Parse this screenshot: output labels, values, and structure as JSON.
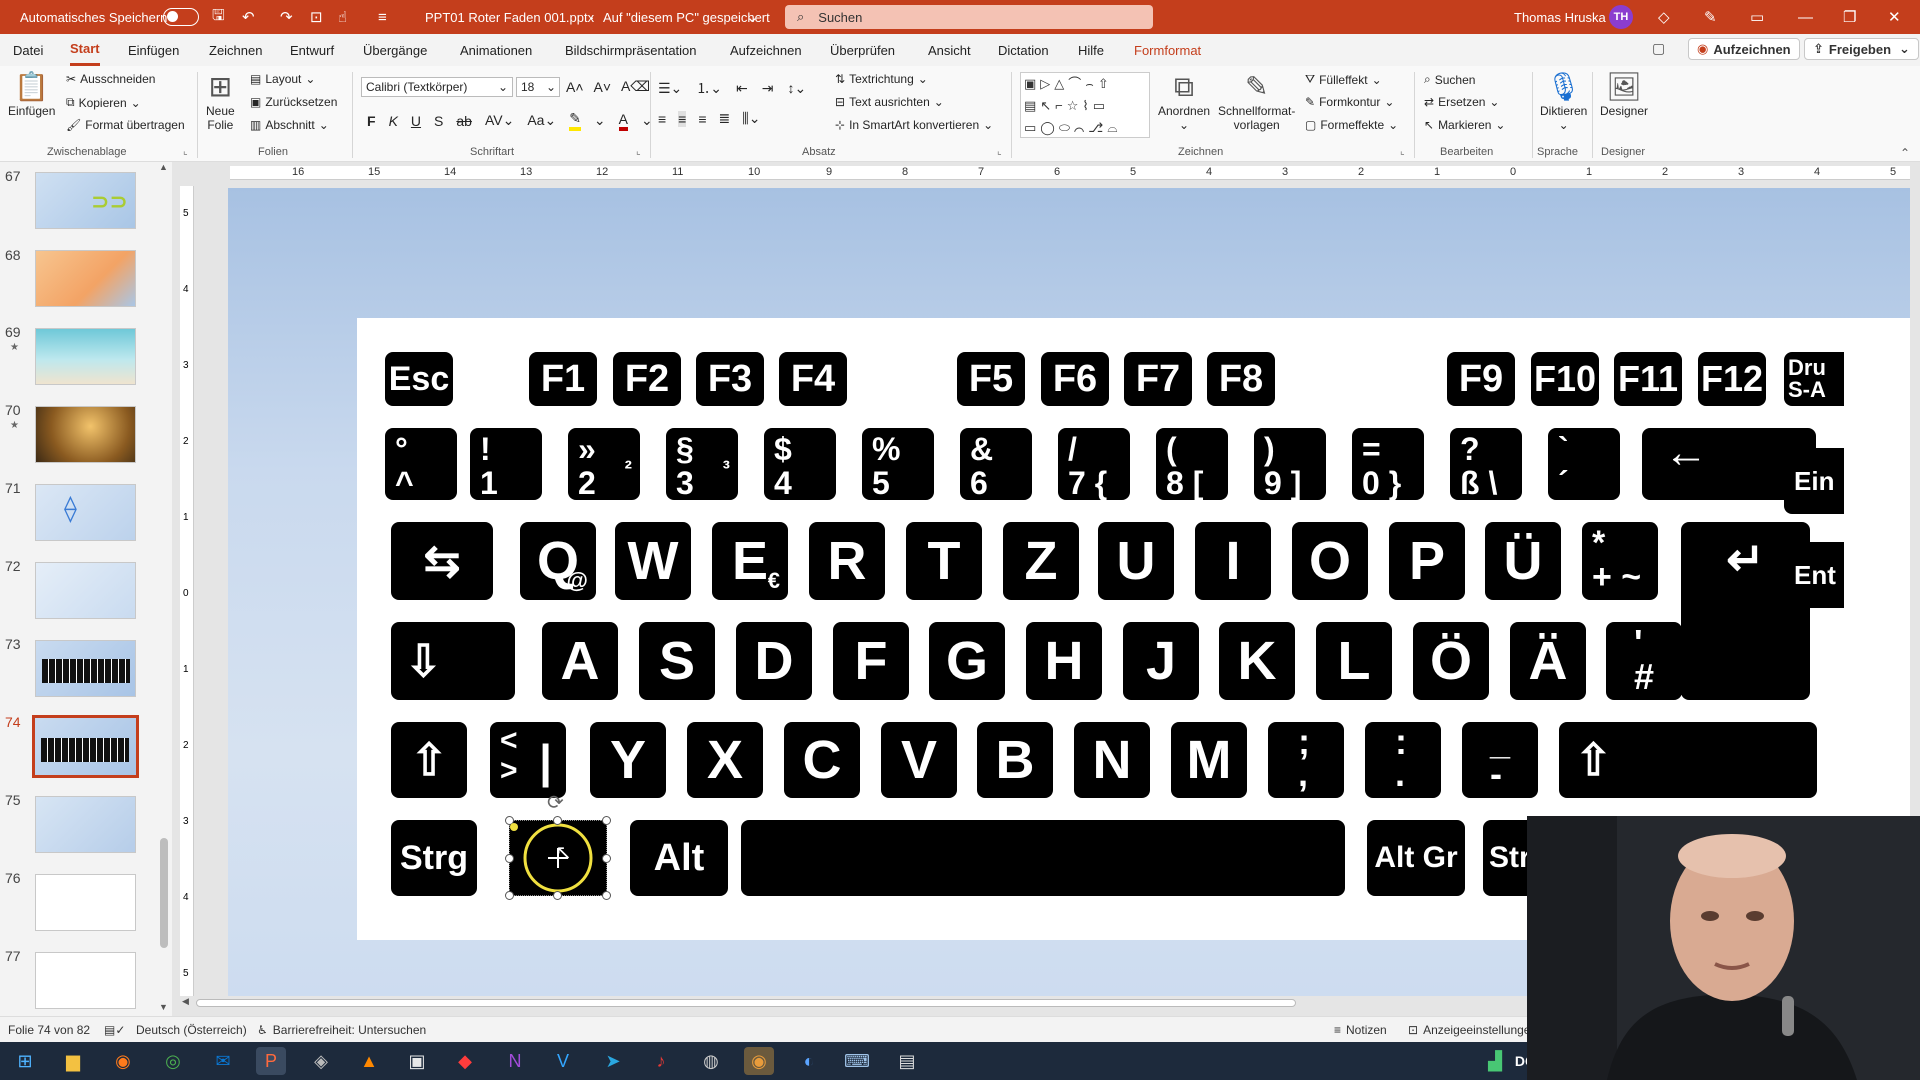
{
  "titlebar": {
    "autosave_label": "Automatisches Speichern",
    "doc_title": "PPT01 Roter Faden 001.pptx",
    "doc_location": "Auf \"diesem PC\" gespeichert",
    "search_placeholder": "Suchen",
    "user_name": "Thomas Hruska",
    "user_initials": "TH"
  },
  "menu": {
    "tabs": [
      "Datei",
      "Start",
      "Einfügen",
      "Zeichnen",
      "Entwurf",
      "Übergänge",
      "Animationen",
      "Bildschirmpräsentation",
      "Aufzeichnen",
      "Überprüfen",
      "Ansicht",
      "Dictation",
      "Hilfe",
      "Formformat"
    ],
    "active_tab": "Start",
    "record_button": "Aufzeichnen",
    "share_button": "Freigeben"
  },
  "ribbon": {
    "clipboard": {
      "paste": "Einfügen",
      "cut": "Ausschneiden",
      "copy": "Kopieren",
      "format_painter": "Format übertragen",
      "group": "Zwischenablage"
    },
    "slides": {
      "new_slide_1": "Neue",
      "new_slide_2": "Folie",
      "layout": "Layout",
      "reset": "Zurücksetzen",
      "section": "Abschnitt",
      "group": "Folien"
    },
    "font": {
      "name": "Calibri (Textkörper)",
      "size": "18",
      "group": "Schriftart"
    },
    "paragraph": {
      "text_direction": "Textrichtung",
      "align_text": "Text ausrichten",
      "smartart": "In SmartArt konvertieren",
      "group": "Absatz"
    },
    "drawing": {
      "arrange": "Anordnen",
      "quick_styles_1": "Schnellformat-",
      "quick_styles_2": "vorlagen",
      "fill": "Fülleffekt",
      "outline": "Formkontur",
      "effects": "Formeffekte",
      "group": "Zeichnen"
    },
    "editing": {
      "find": "Suchen",
      "replace": "Ersetzen",
      "select": "Markieren",
      "group": "Bearbeiten"
    },
    "voice": {
      "dictate": "Diktieren",
      "group": "Sprache"
    },
    "designer": {
      "label": "Designer",
      "group": "Designer"
    }
  },
  "slides_pane": {
    "numbers": [
      "67",
      "68",
      "69",
      "70",
      "71",
      "72",
      "73",
      "74",
      "75",
      "76",
      "77"
    ],
    "active": "74"
  },
  "ruler": {
    "top": [
      "16",
      "15",
      "14",
      "13",
      "12",
      "11",
      "10",
      "9",
      "8",
      "7",
      "6",
      "5",
      "4",
      "3",
      "2",
      "1",
      "0",
      "1",
      "2",
      "3",
      "4",
      "5"
    ],
    "left": [
      "5",
      "4",
      "3",
      "2",
      "1",
      "0",
      "1",
      "2",
      "3",
      "4",
      "5"
    ]
  },
  "keyboard": {
    "row_f": [
      "Esc",
      "F1",
      "F2",
      "F3",
      "F4",
      "F5",
      "F6",
      "F7",
      "F8",
      "F9",
      "F10",
      "F11",
      "F12"
    ],
    "row_f_partial": "Dru\nS-A",
    "row_num": [
      {
        "top": "°",
        "bottom": "^"
      },
      {
        "top": "!",
        "bottom": "1"
      },
      {
        "top": "»",
        "bottom": "2",
        "sub": "²"
      },
      {
        "top": "§",
        "bottom": "3",
        "sub": "³"
      },
      {
        "top": "$",
        "bottom": "4"
      },
      {
        "top": "%",
        "bottom": "5"
      },
      {
        "top": "&",
        "bottom": "6"
      },
      {
        "top": "/",
        "bottom": "7 {"
      },
      {
        "top": "(",
        "bottom": "8 ["
      },
      {
        "top": ")",
        "bottom": "9 ]"
      },
      {
        "top": "=",
        "bottom": "0 }"
      },
      {
        "top": "?",
        "bottom": "ß \\"
      },
      {
        "top": "`",
        "bottom": "´"
      }
    ],
    "row_num_partial": "Ein",
    "row_q": [
      "Q",
      "W",
      "E",
      "R",
      "T",
      "Z",
      "U",
      "I",
      "O",
      "P",
      "Ü"
    ],
    "q_sub": "@",
    "e_sub": "€",
    "plus_key": {
      "top": "*",
      "bottom": "+ ~"
    },
    "row_q_partial": "Ent",
    "row_a": [
      "A",
      "S",
      "D",
      "F",
      "G",
      "H",
      "J",
      "K",
      "L",
      "Ö",
      "Ä"
    ],
    "hash_key": {
      "top": "'",
      "bottom": "#"
    },
    "row_y": [
      "Y",
      "X",
      "C",
      "V",
      "B",
      "N",
      "M"
    ],
    "lt_key": {
      "top": "<",
      "bottom": ">",
      "sub": "|"
    },
    "semi_key": {
      "top": ";",
      "bottom": ","
    },
    "colon_key": {
      "top": ":",
      "bottom": "."
    },
    "dash_key": {
      "top": "_",
      "bottom": "-"
    },
    "row_bottom": [
      "Strg",
      "Alt",
      "Alt Gr"
    ],
    "row_bottom_partial": "Str"
  },
  "statusbar": {
    "slide_info": "Folie 74 von 82",
    "language": "Deutsch (Österreich)",
    "accessibility": "Barrierefreiheit: Untersuchen",
    "notes": "Notizen",
    "display_settings": "Anzeigeeinstellungen"
  },
  "taskbar": {
    "tray_partial": "DC"
  },
  "colors": {
    "accent": "#c43e1c",
    "selection_circle": "#f0e040"
  }
}
